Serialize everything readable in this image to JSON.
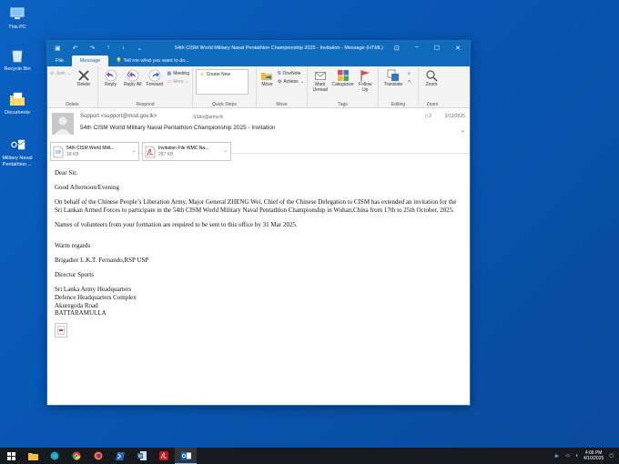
{
  "desktop": {
    "icons": [
      {
        "label": "This PC"
      },
      {
        "label": "Recycle Bin"
      },
      {
        "label": "Documents"
      },
      {
        "label": "Military Naval Pentathlon ..."
      }
    ]
  },
  "window": {
    "title": "54th CISM World Military Naval Pentathlon Championship 2025 - Invitation - Message (HTML)",
    "tabs": [
      "File",
      "Message"
    ],
    "active_tab": "Message",
    "tell_me": "Tell me what you want to do..."
  },
  "ribbon": {
    "delete": {
      "junk": "Junk",
      "delete": "Delete",
      "label": "Delete"
    },
    "respond": {
      "reply": "Reply",
      "reply_all": "Reply All",
      "forward": "Forward",
      "meeting": "Meeting",
      "more": "More",
      "label": "Respond"
    },
    "quick_steps": {
      "create_new": "Create New",
      "label": "Quick Steps"
    },
    "move": {
      "move": "Move",
      "onenote": "OneNote",
      "actions": "Actions",
      "label": "Move"
    },
    "tags": {
      "mark_unread": "Mark Unread",
      "categorize": "Categorize",
      "follow_up": "Follow Up",
      "label": "Tags"
    },
    "editing": {
      "translate": "Translate",
      "label": "Editing"
    },
    "zoom": {
      "zoom": "Zoom",
      "label": "Zoom"
    }
  },
  "message": {
    "sender": "Support <support@mod.gov.lk>",
    "to": "SSdo@army.lk",
    "subject": "54th CISM World Military Naval Pentathlon Championship 2025 - Invitation",
    "date": "3/12/2025",
    "reply_count": "2",
    "attachments": [
      {
        "name": "54th CISM World Milit...",
        "size": "18 KB"
      },
      {
        "name": "Invitation File WMC Na...",
        "size": "287 KB"
      }
    ],
    "body": {
      "greeting": "Dear Sir,",
      "opening": "Good Afternoon/Evening",
      "paragraph1": "On behalf of the Chinese People’s Liberation Army, Major General ZHENG Wei, Chief of the Chinese Delegation to CISM has extended an invitation for the Sri Lankan Armed Forces to participate in the 54th CISM World Military Naval Pentathlon Championship in Wuhan,China from 17th to 25th October, 2025.",
      "paragraph2": "Names of volunteers from your formation are required to be sent to this office by 31 Mar 2025.",
      "closing": "Warm regards",
      "signatory": "Brigadier L.K.T. Fernando,RSP USP",
      "position": "Director Sports",
      "address": [
        "Sri Lanka Army Headquarters",
        "Defence Headquarters Complex",
        "Akuregoda Road",
        "BATTARAMULLA"
      ]
    }
  },
  "taskbar": {
    "time": "4:06 PM",
    "date": "4/10/2025"
  },
  "colors": {
    "desktop": "#0a59b6",
    "outlook_blue": "#0f6cbd",
    "taskbar": "#16191e"
  }
}
